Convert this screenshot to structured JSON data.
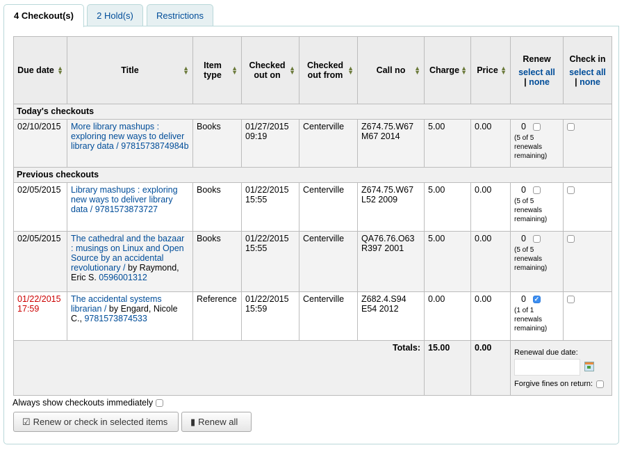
{
  "tabs": [
    {
      "label": "4 Checkout(s)",
      "active": true
    },
    {
      "label": "2 Hold(s)",
      "active": false
    },
    {
      "label": "Restrictions",
      "active": false
    }
  ],
  "table": {
    "headers": {
      "due_date": "Due date",
      "title": "Title",
      "item_type": "Item type",
      "checked_out_on": "Checked out on",
      "checked_out_from": "Checked out from",
      "call_no": "Call no",
      "charge": "Charge",
      "price": "Price",
      "renew": "Renew",
      "check_in": "Check in",
      "select_all": "select all",
      "sep": "|",
      "none": "none"
    },
    "groups": {
      "today": "Today's checkouts",
      "previous": "Previous checkouts"
    },
    "rows": [
      {
        "due_date": "02/10/2015",
        "title": "More library mashups : exploring new ways to deliver library data / 9781573874984b",
        "item_type": "Books",
        "checked_out_on": "01/27/2015 09:19",
        "checked_out_from": "Centerville",
        "call_no": "Z674.75.W67 M67 2014",
        "charge": "5.00",
        "price": "0.00",
        "renew_count": "0",
        "renewals_note": "(5 of 5 renewals remaining)",
        "renew_checked": false,
        "checkin_checked": false
      },
      {
        "due_date": "02/05/2015",
        "title": "Library mashups : exploring new ways to deliver library data / 9781573873727",
        "item_type": "Books",
        "checked_out_on": "01/22/2015 15:55",
        "checked_out_from": "Centerville",
        "call_no": "Z674.75.W67 L52 2009",
        "charge": "5.00",
        "price": "0.00",
        "renew_count": "0",
        "renewals_note": "(5 of 5 renewals remaining)",
        "renew_checked": false,
        "checkin_checked": false
      },
      {
        "due_date": "02/05/2015",
        "title_link": "The cathedral and the bazaar : musings on Linux and Open Source by an accidental revolutionary /",
        "title_author": " by Raymond, Eric S. ",
        "title_isbn": "0596001312",
        "item_type": "Books",
        "checked_out_on": "01/22/2015 15:55",
        "checked_out_from": "Centerville",
        "call_no": "QA76.76.O63 R397 2001",
        "charge": "5.00",
        "price": "0.00",
        "renew_count": "0",
        "renewals_note": "(5 of 5 renewals remaining)",
        "renew_checked": false,
        "checkin_checked": false
      },
      {
        "due_date": "01/22/2015 17:59",
        "overdue": true,
        "title_link": "The accidental systems librarian /",
        "title_author": " by Engard, Nicole C., ",
        "title_isbn": "9781573874533",
        "item_type": "Reference",
        "checked_out_on": "01/22/2015 15:59",
        "checked_out_from": "Centerville",
        "call_no": "Z682.4.S94 E54 2012",
        "charge": "0.00",
        "price": "0.00",
        "renew_count": "0",
        "renewals_note": "(1 of 1 renewals remaining)",
        "renew_checked": true,
        "checkin_checked": false
      }
    ],
    "totals": {
      "label": "Totals:",
      "charge": "15.00",
      "price": "0.00",
      "renewal_due_date_label": "Renewal due date:",
      "renewal_due_date_value": "",
      "forgive_label": "Forgive fines on return:",
      "forgive_checked": false
    }
  },
  "always_show_label": "Always show checkouts immediately",
  "always_show_checked": false,
  "buttons": {
    "renew_checkin": "Renew or check in selected items",
    "renew_all": "Renew all"
  },
  "colors": {
    "link": "#004d99",
    "overdue": "#cc0000",
    "tab_bg": "#e6f0f2",
    "border": "#b9d8d9",
    "checkbox_checked": "#3d8ef0"
  }
}
